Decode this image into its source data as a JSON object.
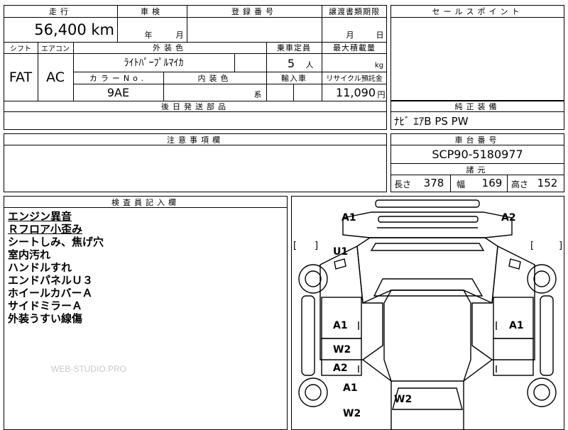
{
  "mileage": {
    "label": "走行",
    "value": "56,400 km"
  },
  "inspection": {
    "label": "車検",
    "year_unit": "年",
    "month_unit": "月"
  },
  "registration": {
    "label": "登録番号",
    "value": ""
  },
  "transfer_deadline": {
    "label": "譲渡書類期限",
    "month_unit": "月",
    "day_unit": "日"
  },
  "sales_point": {
    "label": "セールスポイント",
    "value": ""
  },
  "shift": {
    "label": "シフト",
    "value": "FAT"
  },
  "aircon": {
    "label": "エアコン",
    "value": "AC"
  },
  "exterior_color": {
    "label": "外装色",
    "value": "ﾗｲﾄﾊﾟｰﾌﾟﾙﾏｲｶ"
  },
  "capacity": {
    "label": "乗車定員",
    "value": "5",
    "unit": "人"
  },
  "max_load": {
    "label": "最大積載量",
    "unit": "kg"
  },
  "color_no": {
    "label": "カラーNo.",
    "value": "9AE"
  },
  "interior_color": {
    "label": "内装色",
    "suffix": "系"
  },
  "import": {
    "label": "輸入車"
  },
  "recycle": {
    "label": "リサイクル預託金",
    "value": "11,090",
    "unit": "円"
  },
  "later_parts": {
    "label": "後日発送部品",
    "value": ""
  },
  "standard_equipment": {
    "label": "純正装備",
    "value": "ﾅﾋﾞ ｴｱB PS PW"
  },
  "caution": {
    "label": "注意事項欄",
    "value": ""
  },
  "chassis": {
    "label": "車台番号",
    "value": "SCP90-5180977"
  },
  "dimensions": {
    "label": "諸元",
    "length_label": "長さ",
    "length": "378",
    "width_label": "幅",
    "width": "169",
    "height_label": "高さ",
    "height": "152"
  },
  "inspector_notes": {
    "label": "検査員記入欄",
    "lines": [
      "エンジン異音",
      "Ｒフロア小歪み",
      "シートしみ、焦げ穴",
      "室内汚れ",
      "ハンドルすれ",
      "エンドパネルＵ３",
      "ホイールカバーＡ",
      "サイドミラーＡ",
      "外装うすい線傷"
    ]
  },
  "watermark": "WEB-STUDIO.PRO",
  "damage_map": {
    "a1_front_left": "A1",
    "a2_front_right": "A2",
    "u1": "U1",
    "a1_left_door": "A1",
    "a1_right_door": "A1",
    "w2_left_rear_door": "W2",
    "a2_left_rear": "A2",
    "a1_left_wheel": "A1",
    "w2_rear": "W2",
    "w2_left_bottom": "W2",
    "bracket_open": "[",
    "bracket_close": "]"
  }
}
